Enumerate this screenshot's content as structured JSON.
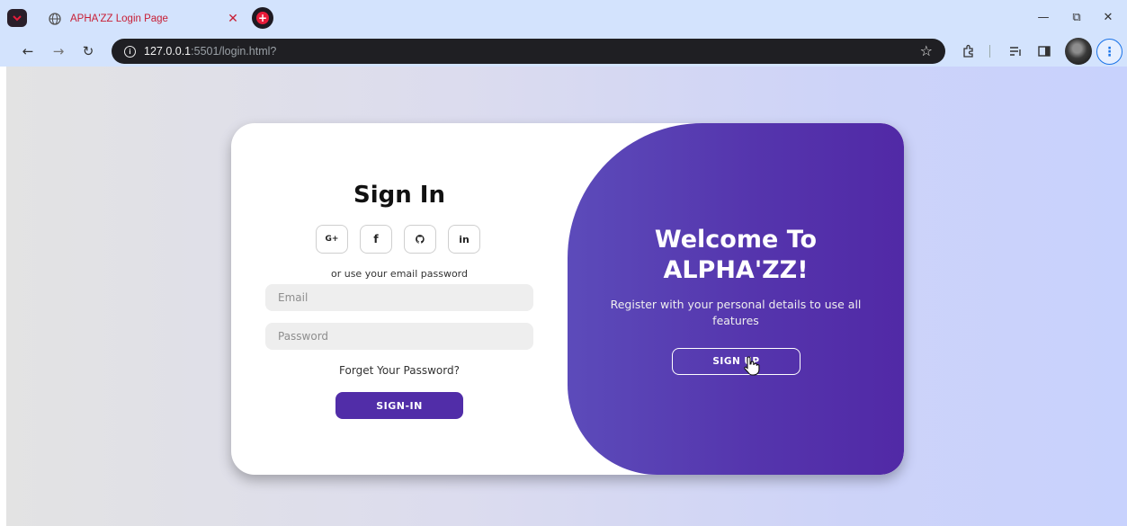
{
  "browser": {
    "tab_title": "APHA'ZZ Login Page",
    "tab_close": "✕",
    "url_host": "127.0.0.1",
    "url_rest": ":5501/login.html?"
  },
  "login": {
    "title": "Sign In",
    "social_buttons": [
      {
        "label": "G+",
        "icon": "google-plus-icon"
      },
      {
        "label": "f",
        "icon": "facebook-icon"
      },
      {
        "label": "",
        "icon": "github-icon"
      },
      {
        "label": "in",
        "icon": "linkedin-icon"
      }
    ],
    "alt_text": "or use your email password",
    "email_placeholder": "Email",
    "password_placeholder": "Password",
    "forgot_link": "Forget Your Password?",
    "signin_button": "SIGN-IN"
  },
  "welcome": {
    "title_line1": "Welcome To",
    "title_line2": "ALPHA'ZZ!",
    "text": "Register with your personal details to use all features",
    "signup_button": "SIGN UP"
  },
  "colors": {
    "accent": "#512da8",
    "panel_gradient_start": "#5c4bba",
    "panel_gradient_end": "#5129a6"
  }
}
